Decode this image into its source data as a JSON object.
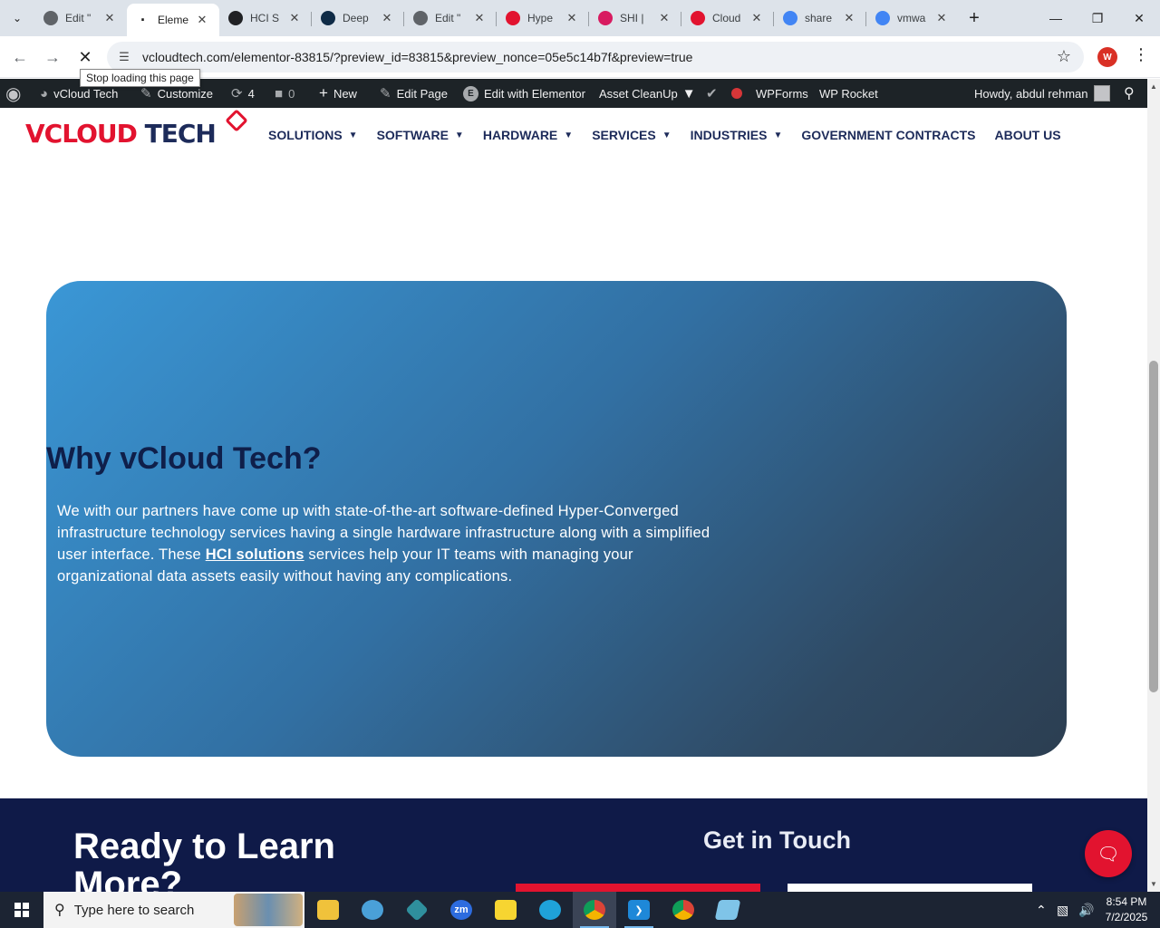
{
  "browser": {
    "tabs": [
      {
        "label": "Edit \"",
        "favicon": "wordpress-icon",
        "color": "#5f6368",
        "active": false
      },
      {
        "label": "Eleme",
        "favicon": "loading-icon",
        "color": "#1f1f1f",
        "active": true
      },
      {
        "label": "HCI S",
        "favicon": "globe-icon",
        "color": "#202124",
        "active": false
      },
      {
        "label": "Deep",
        "favicon": "deepl-icon",
        "color": "#0f2b46",
        "active": false
      },
      {
        "label": "Edit \"",
        "favicon": "wordpress-icon",
        "color": "#5f6368",
        "active": false
      },
      {
        "label": "Hype",
        "favicon": "vcloud-icon",
        "color": "#e2132f",
        "active": false
      },
      {
        "label": "SHI | ",
        "favicon": "shi-icon",
        "color": "#d81b60",
        "active": false
      },
      {
        "label": "Cloud",
        "favicon": "cloud-icon",
        "color": "#e2132f",
        "active": false
      },
      {
        "label": "share",
        "favicon": "google-icon",
        "color": "#4285f4",
        "active": false
      },
      {
        "label": "vmwa",
        "favicon": "google-icon",
        "color": "#4285f4",
        "active": false
      }
    ],
    "url": "vcloudtech.com/elementor-83815/?preview_id=83815&preview_nonce=05e5c14b7f&preview=true",
    "tooltip": "Stop loading this page",
    "profile_initial": "W"
  },
  "adminbar": {
    "site_name": "vCloud Tech",
    "customize": "Customize",
    "updates_count": "4",
    "comments_count": "0",
    "new": "New",
    "edit_page": "Edit Page",
    "edit_elementor": "Edit with Elementor",
    "asset_cleanup": "Asset CleanUp",
    "wpforms": "WPForms",
    "wp_rocket": "WP Rocket",
    "howdy": "Howdy, abdul rehman"
  },
  "site": {
    "logo_red": "VCLOUD",
    "logo_blue": " TECH",
    "nav": [
      {
        "label": "SOLUTIONS",
        "dropdown": true
      },
      {
        "label": "SOFTWARE",
        "dropdown": true
      },
      {
        "label": "HARDWARE",
        "dropdown": true
      },
      {
        "label": "SERVICES",
        "dropdown": true
      },
      {
        "label": "INDUSTRIES",
        "dropdown": true
      },
      {
        "label": "GOVERNMENT CONTRACTS",
        "dropdown": false
      },
      {
        "label": "ABOUT US",
        "dropdown": false
      }
    ]
  },
  "hero": {
    "title": "Why vCloud Tech?",
    "body_before": "We with our partners have come up with state-of-the-art software-defined Hyper-Converged infrastructure technology services having a single hardware infrastructure along with a simplified user interface. These ",
    "link_text": "HCI solutions",
    "body_after": " services help your IT teams with managing your organizational data assets easily without having any complications."
  },
  "cta": {
    "title": "Ready to Learn More?",
    "subtitle": "Get in Touch"
  },
  "taskbar": {
    "search_placeholder": "Type here to search",
    "time": "8:54 PM",
    "date": "7/2/2025"
  }
}
